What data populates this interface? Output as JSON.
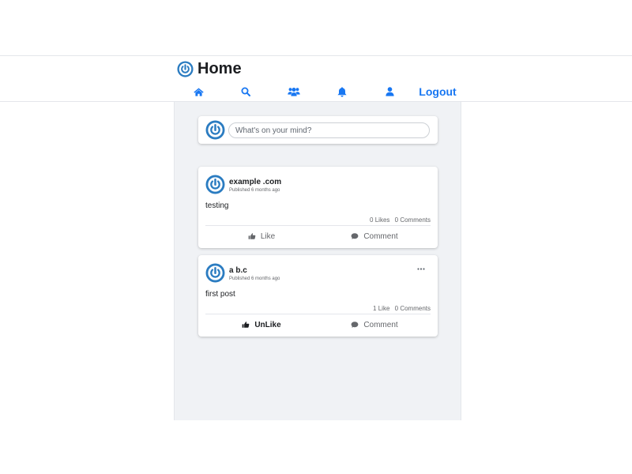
{
  "header": {
    "title": "Home",
    "logo_icon": "power-logo-icon",
    "nav": [
      {
        "name": "home",
        "icon": "home-icon"
      },
      {
        "name": "search",
        "icon": "search-icon"
      },
      {
        "name": "friends",
        "icon": "users-icon"
      },
      {
        "name": "notifications",
        "icon": "bell-icon"
      },
      {
        "name": "profile",
        "icon": "user-icon"
      }
    ],
    "logout_label": "Logout"
  },
  "composer": {
    "placeholder": "What's on your mind?"
  },
  "posts": [
    {
      "author": "example .com",
      "published": "Published 6 months ago",
      "text": "testing",
      "likes": "0 Likes",
      "comments": "0 Comments",
      "like_label": "Like",
      "comment_label": "Comment",
      "liked": false
    },
    {
      "author": "a b.c",
      "published": "Published 6 months ago",
      "text": "first post",
      "likes": "1 Like",
      "comments": "0 Comments",
      "like_label": "UnLike",
      "comment_label": "Comment",
      "liked": true,
      "has_menu": true
    }
  ],
  "colors": {
    "accent": "#1877f2",
    "logo": "#2b7cc1",
    "feed_bg": "#f0f2f5",
    "muted": "#65676b"
  }
}
